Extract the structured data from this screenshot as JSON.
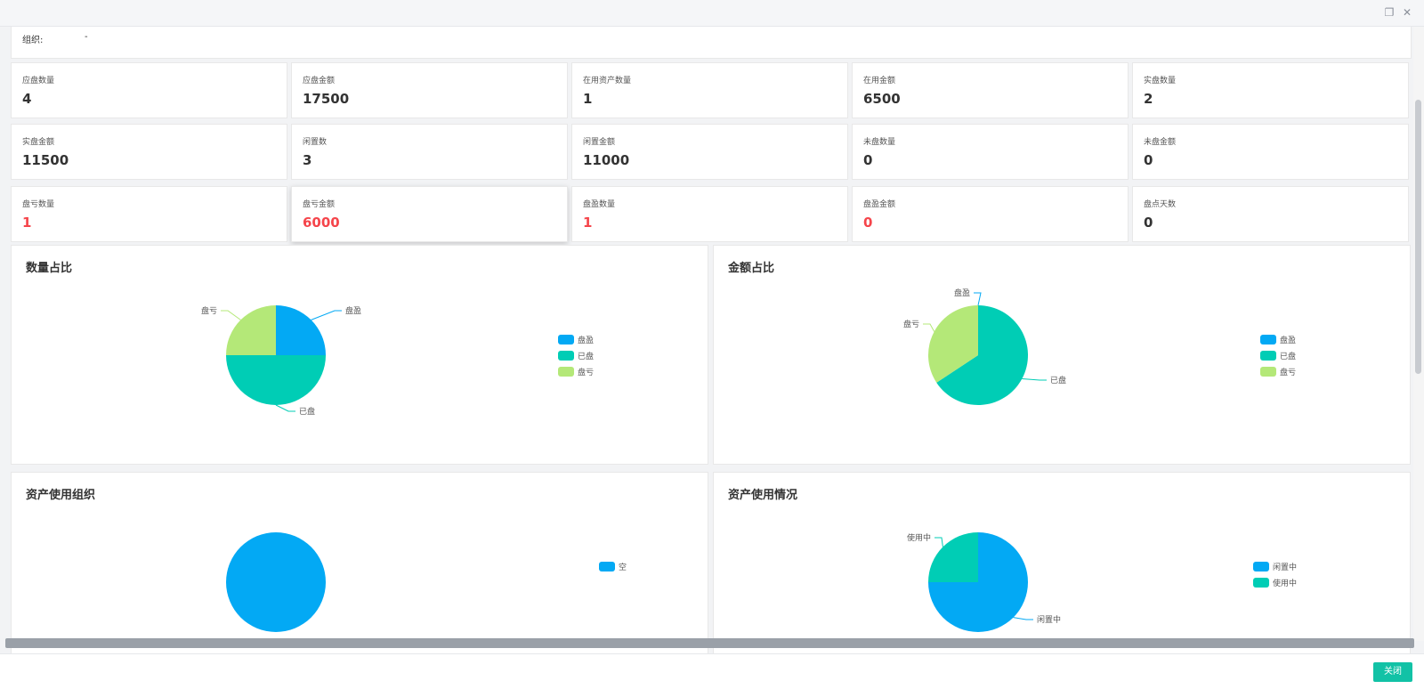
{
  "org": {
    "label": "组织:",
    "value": "-"
  },
  "stats": [
    {
      "label": "应盘数量",
      "value": "4"
    },
    {
      "label": "应盘金额",
      "value": "17500"
    },
    {
      "label": "在用资产数量",
      "value": "1"
    },
    {
      "label": "在用金额",
      "value": "6500"
    },
    {
      "label": "实盘数量",
      "value": "2"
    },
    {
      "label": "实盘金额",
      "value": "11500"
    },
    {
      "label": "闲置数",
      "value": "3"
    },
    {
      "label": "闲置金额",
      "value": "11000"
    },
    {
      "label": "未盘数量",
      "value": "0"
    },
    {
      "label": "未盘金额",
      "value": "0"
    },
    {
      "label": "盘亏数量",
      "value": "1",
      "highlight": true
    },
    {
      "label": "盘亏金额",
      "value": "6000",
      "highlight": true
    },
    {
      "label": "盘盈数量",
      "value": "1",
      "highlight": true
    },
    {
      "label": "盘盈金额",
      "value": "0",
      "highlight": true
    },
    {
      "label": "盘点天数",
      "value": "0"
    }
  ],
  "colors": {
    "blue": "#03a9f4",
    "teal": "#00cdb5",
    "green": "#b4e878",
    "accent": "#12c2a6",
    "red": "#f5454b"
  },
  "panels": {
    "quantity": {
      "title": "数量占比"
    },
    "amount": {
      "title": "金额占比"
    },
    "org_usage": {
      "title": "资产使用组织"
    },
    "usage": {
      "title": "资产使用情况"
    }
  },
  "chart_data": [
    {
      "type": "pie",
      "title": "数量占比",
      "legend_position": "right",
      "series": [
        {
          "name": "盘盈",
          "value": 1,
          "color": "#03a9f4"
        },
        {
          "name": "已盘",
          "value": 2,
          "color": "#00cdb5"
        },
        {
          "name": "盘亏",
          "value": 1,
          "color": "#b4e878"
        }
      ]
    },
    {
      "type": "pie",
      "title": "金额占比",
      "legend_position": "right",
      "series": [
        {
          "name": "盘盈",
          "value": 0,
          "color": "#03a9f4"
        },
        {
          "name": "已盘",
          "value": 11500,
          "color": "#00cdb5"
        },
        {
          "name": "盘亏",
          "value": 6000,
          "color": "#b4e878"
        }
      ]
    },
    {
      "type": "pie",
      "title": "资产使用组织",
      "legend_position": "right",
      "series": [
        {
          "name": "空",
          "value": 1,
          "color": "#03a9f4"
        }
      ]
    },
    {
      "type": "pie",
      "title": "资产使用情况",
      "legend_position": "right",
      "series": [
        {
          "name": "闲置中",
          "value": 3,
          "color": "#03a9f4"
        },
        {
          "name": "使用中",
          "value": 1,
          "color": "#00cdb5"
        }
      ]
    }
  ],
  "footer": {
    "close_label": "关闭"
  }
}
